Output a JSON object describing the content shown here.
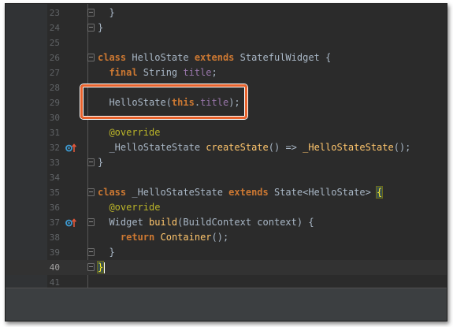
{
  "editor": {
    "lines": [
      {
        "n": "23",
        "tokens": [
          {
            "t": "  }",
            "c": "pl"
          }
        ],
        "fold": true
      },
      {
        "n": "24",
        "tokens": [
          {
            "t": "}",
            "c": "pl"
          }
        ],
        "fold": true
      },
      {
        "n": "25",
        "tokens": []
      },
      {
        "n": "26",
        "tokens": [
          {
            "t": "class",
            "c": "kw"
          },
          {
            "t": " HelloState ",
            "c": "pl"
          },
          {
            "t": "extends",
            "c": "kw"
          },
          {
            "t": " StatefulWidget {",
            "c": "pl"
          }
        ],
        "fold": true
      },
      {
        "n": "27",
        "tokens": [
          {
            "t": "  ",
            "c": "pl"
          },
          {
            "t": "final",
            "c": "kw"
          },
          {
            "t": " String ",
            "c": "pl"
          },
          {
            "t": "title",
            "c": "fld"
          },
          {
            "t": ";",
            "c": "pl"
          }
        ]
      },
      {
        "n": "28",
        "tokens": []
      },
      {
        "n": "29",
        "tokens": [
          {
            "t": "  HelloState(",
            "c": "pl"
          },
          {
            "t": "this",
            "c": "kw"
          },
          {
            "t": ".",
            "c": "pl"
          },
          {
            "t": "title",
            "c": "fld"
          },
          {
            "t": ");",
            "c": "pl"
          }
        ]
      },
      {
        "n": "30",
        "tokens": []
      },
      {
        "n": "31",
        "tokens": [
          {
            "t": "  ",
            "c": "pl"
          },
          {
            "t": "@override",
            "c": "ann"
          }
        ]
      },
      {
        "n": "32",
        "tokens": [
          {
            "t": "  _HelloStateState ",
            "c": "pl"
          },
          {
            "t": "createState",
            "c": "fn"
          },
          {
            "t": "() => ",
            "c": "pl"
          },
          {
            "t": "_HelloStateState",
            "c": "fn"
          },
          {
            "t": "();",
            "c": "pl"
          }
        ],
        "gutter_icon": "override-marker-icon"
      },
      {
        "n": "33",
        "tokens": [
          {
            "t": "}",
            "c": "pl"
          }
        ],
        "fold": true
      },
      {
        "n": "34",
        "tokens": []
      },
      {
        "n": "35",
        "tokens": [
          {
            "t": "class",
            "c": "kw"
          },
          {
            "t": " _HelloStateState ",
            "c": "pl"
          },
          {
            "t": "extends",
            "c": "kw"
          },
          {
            "t": " State<HelloState> ",
            "c": "pl"
          },
          {
            "t": "{",
            "c": "brace-hl"
          }
        ],
        "fold": true
      },
      {
        "n": "36",
        "tokens": [
          {
            "t": "  ",
            "c": "pl"
          },
          {
            "t": "@override",
            "c": "ann"
          }
        ]
      },
      {
        "n": "37",
        "tokens": [
          {
            "t": "  Widget ",
            "c": "pl"
          },
          {
            "t": "build",
            "c": "fn"
          },
          {
            "t": "(BuildContext context) {",
            "c": "pl"
          }
        ],
        "fold": true,
        "gutter_icon": "override-marker-icon"
      },
      {
        "n": "38",
        "tokens": [
          {
            "t": "    ",
            "c": "pl"
          },
          {
            "t": "return",
            "c": "kw"
          },
          {
            "t": " ",
            "c": "pl"
          },
          {
            "t": "Container",
            "c": "fn"
          },
          {
            "t": "();",
            "c": "pl"
          }
        ]
      },
      {
        "n": "39",
        "tokens": [
          {
            "t": "  }",
            "c": "pl"
          }
        ],
        "fold": true
      },
      {
        "n": "40",
        "tokens": [
          {
            "t": "}",
            "c": "brace-hl"
          }
        ],
        "fold": true,
        "current": true,
        "cursor": true
      },
      {
        "n": "41",
        "tokens": []
      }
    ],
    "colors": {
      "background": "#2b2b2b",
      "keyword": "#cc7832",
      "field": "#9876aa",
      "function": "#ffc66d",
      "annotation": "#bbb529",
      "highlight_box": "#e8622c"
    }
  }
}
